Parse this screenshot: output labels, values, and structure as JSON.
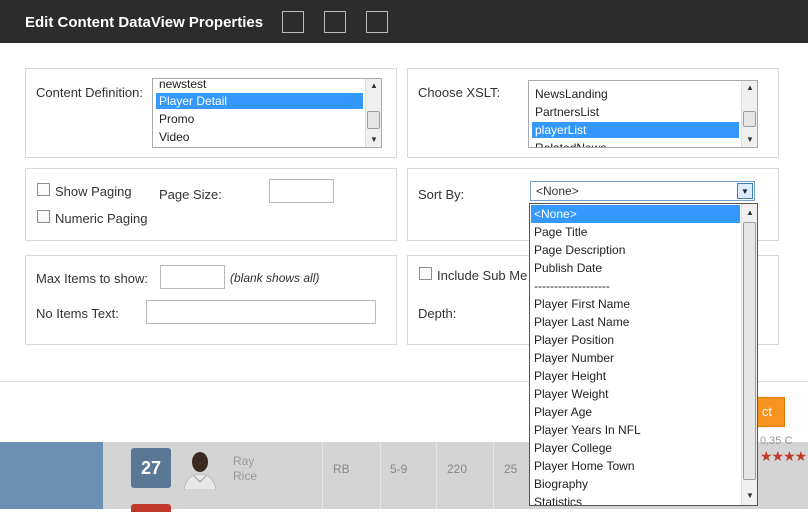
{
  "title_bar": {
    "title": "Edit Content DataView Properties",
    "buttons": [
      "",
      "",
      ""
    ]
  },
  "content_definition": {
    "label": "Content Definition:",
    "items": [
      "newstest",
      "Player Detail",
      "Promo",
      "Video"
    ],
    "selected": "Player Detail"
  },
  "choose_xslt": {
    "label": "Choose XSLT:",
    "items": [
      "NewsLanding",
      "PartnersList",
      "playerList",
      "RelatedNews"
    ],
    "selected": "playerList"
  },
  "paging": {
    "show_paging_label": "Show Paging",
    "numeric_paging_label": "Numeric Paging",
    "page_size_label": "Page Size:",
    "page_size_value": ""
  },
  "sort_by": {
    "label": "Sort By:",
    "selected": "<None>",
    "options": [
      "<None>",
      "Page Title",
      "Page Description",
      "Publish Date",
      "-------------------",
      "Player First Name",
      "Player Last Name",
      "Player Position",
      "Player Number",
      "Player Height",
      "Player Weight",
      "Player Age",
      "Player Years In NFL",
      "Player College",
      "Player Home Town",
      "Biography",
      "Statistics"
    ]
  },
  "max_items": {
    "label": "Max Items to show:",
    "value": "",
    "hint": "(blank shows all)",
    "no_items_label": "No Items Text:",
    "no_items_value": ""
  },
  "sub_menu": {
    "include_label": "Include Sub Me",
    "depth_label": "Depth:"
  },
  "footer": {
    "select_button": "ct"
  },
  "background_row": {
    "number": "27",
    "first_name": "Ray",
    "last_name": "Rice",
    "position": "RB",
    "height": "5-9",
    "weight": "220",
    "age": "25",
    "stars": "★★★★",
    "price_fragment": "0,35 C"
  }
}
